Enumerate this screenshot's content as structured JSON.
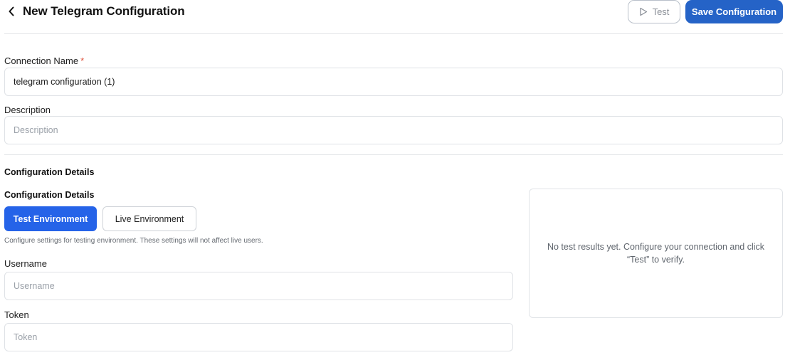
{
  "header": {
    "title": "New Telegram Configuration",
    "test_label": "Test",
    "save_label": "Save Configuration"
  },
  "form": {
    "connection_name_label": "Connection Name",
    "required_mark": "*",
    "connection_name_value": "telegram configuration (1)",
    "description_label": "Description",
    "description_placeholder": "Description"
  },
  "config": {
    "section_title": "Configuration Details",
    "subsection_title": "Configuration Details",
    "env_tabs": [
      {
        "label": "Test Environment",
        "active": true
      },
      {
        "label": "Live Environment",
        "active": false
      }
    ],
    "helper_text": "Configure settings for testing environment. These settings will not affect live users.",
    "username_label": "Username",
    "username_placeholder": "Username",
    "token_label": "Token",
    "token_placeholder": "Token"
  },
  "results": {
    "empty_text": "No test results yet. Configure your connection and click “Test” to verify."
  },
  "colors": {
    "primary": "#2563c7",
    "tab_active": "#2563e8",
    "required": "#e0553f"
  },
  "icons": {
    "back": "chevron-left-icon",
    "test": "play-icon"
  }
}
